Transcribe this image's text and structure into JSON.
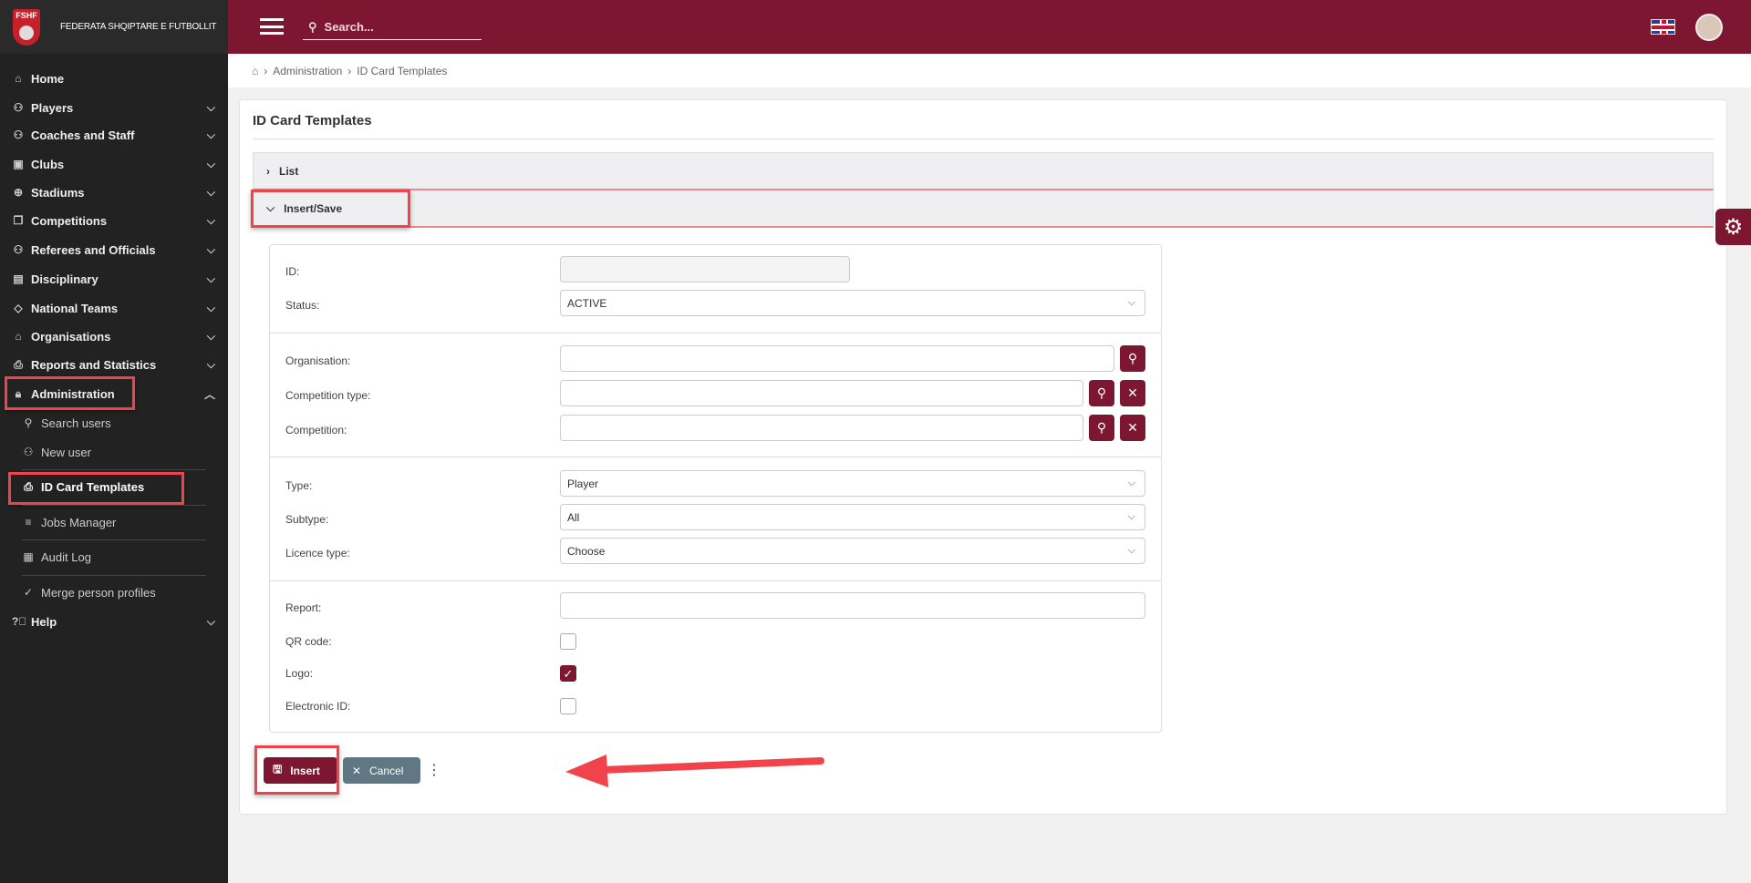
{
  "brand": {
    "logo_text": "FSHF",
    "name": "FEDERATA SHQIPTARE E FUTBOLLIT"
  },
  "topbar": {
    "search_placeholder": "Search...",
    "language": "en-GB"
  },
  "breadcrumb": [
    "Administration",
    "ID Card Templates"
  ],
  "sidebar": {
    "items": [
      {
        "label": "Home",
        "icon": "home-icon"
      },
      {
        "label": "Players",
        "icon": "users-icon"
      },
      {
        "label": "Coaches and Staff",
        "icon": "users-icon"
      },
      {
        "label": "Clubs",
        "icon": "club-icon"
      },
      {
        "label": "Stadiums",
        "icon": "globe-icon"
      },
      {
        "label": "Competitions",
        "icon": "copy-icon"
      },
      {
        "label": "Referees and Officials",
        "icon": "users-icon"
      },
      {
        "label": "Disciplinary",
        "icon": "briefcase-icon"
      },
      {
        "label": "National Teams",
        "icon": "tag-icon"
      },
      {
        "label": "Organisations",
        "icon": "home-icon"
      },
      {
        "label": "Reports and Statistics",
        "icon": "printer-icon"
      },
      {
        "label": "Administration",
        "icon": "lock-icon"
      },
      {
        "label": "Help",
        "icon": "help-icon"
      }
    ],
    "admin_sub": [
      {
        "label": "Search users",
        "icon": "search-icon"
      },
      {
        "label": "New user",
        "icon": "user-plus-icon"
      },
      {
        "label": "ID Card Templates",
        "icon": "printer-icon"
      },
      {
        "label": "Jobs Manager",
        "icon": "list-icon"
      },
      {
        "label": "Audit Log",
        "icon": "calendar-icon"
      },
      {
        "label": "Merge person profiles",
        "icon": "check-icon"
      }
    ]
  },
  "page": {
    "title": "ID Card Templates",
    "accordion_list": "List",
    "accordion_insert": "Insert/Save"
  },
  "form": {
    "id_label": "ID:",
    "id_value": "",
    "status_label": "Status:",
    "status_value": "ACTIVE",
    "organisation_label": "Organisation:",
    "organisation_value": "",
    "competition_type_label": "Competition type:",
    "competition_type_value": "",
    "competition_label": "Competition:",
    "competition_value": "",
    "type_label": "Type:",
    "type_value": "Player",
    "subtype_label": "Subtype:",
    "subtype_value": "All",
    "licence_type_label": "Licence type:",
    "licence_type_value": "Choose",
    "report_label": "Report:",
    "report_value": "",
    "qr_label": "QR code:",
    "qr_checked": false,
    "logo_label": "Logo:",
    "logo_checked": true,
    "eid_label": "Electronic ID:",
    "eid_checked": false
  },
  "actions": {
    "insert": "Insert",
    "cancel": "Cancel"
  },
  "colors": {
    "brand": "#7d1631",
    "sidebar": "#222222",
    "cancel": "#5f7884",
    "annotation": "#f0434b"
  }
}
